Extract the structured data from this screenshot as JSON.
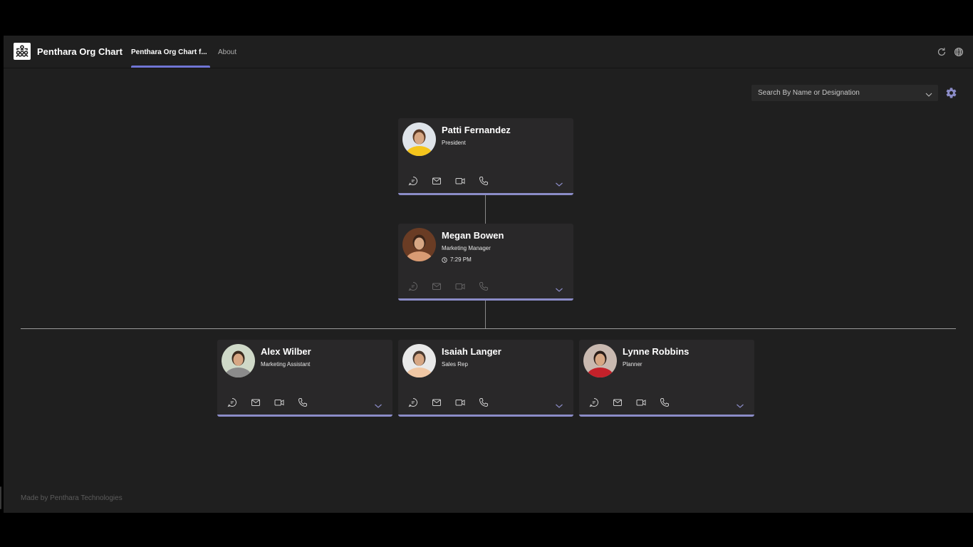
{
  "app": {
    "title": "Penthara Org Chart",
    "tabs": [
      {
        "label": "Penthara Org Chart f...",
        "active": true
      },
      {
        "label": "About",
        "active": false
      }
    ],
    "top_icons": [
      "refresh-icon",
      "globe-icon"
    ]
  },
  "search": {
    "placeholder": "Search By Name or Designation",
    "icon": "chevron-down-icon"
  },
  "settings": {
    "icon": "gear-icon",
    "color": "#8b8cc7"
  },
  "accent_color": "#8b8cc7",
  "people": [
    {
      "name": "Patti Fernandez",
      "role": "President",
      "time": null,
      "actions_enabled": true,
      "avatar_colors": [
        "#f4c51c",
        "#5b3a26",
        "#dfe4ea"
      ]
    },
    {
      "name": "Megan Bowen",
      "role": "Marketing Manager",
      "time": "7:29 PM",
      "actions_enabled": false,
      "avatar_colors": [
        "#d99b73",
        "#3a2418",
        "#6a3c24"
      ]
    },
    {
      "name": "Alex Wilber",
      "role": "Marketing Assistant",
      "time": null,
      "actions_enabled": true,
      "avatar_colors": [
        "#8b8b8b",
        "#3a2a1e",
        "#cfd9c8"
      ]
    },
    {
      "name": "Isaiah Langer",
      "role": "Sales Rep",
      "time": null,
      "actions_enabled": true,
      "avatar_colors": [
        "#f0c7a4",
        "#4a3a30",
        "#e9e9e9"
      ]
    },
    {
      "name": "Lynne Robbins",
      "role": "Planner",
      "time": null,
      "actions_enabled": true,
      "avatar_colors": [
        "#c4212a",
        "#2a1d18",
        "#c9b9b0"
      ]
    }
  ],
  "card_actions": [
    "chat-icon",
    "mail-icon",
    "video-icon",
    "call-icon"
  ],
  "footer": "Made by Penthara Technologies"
}
